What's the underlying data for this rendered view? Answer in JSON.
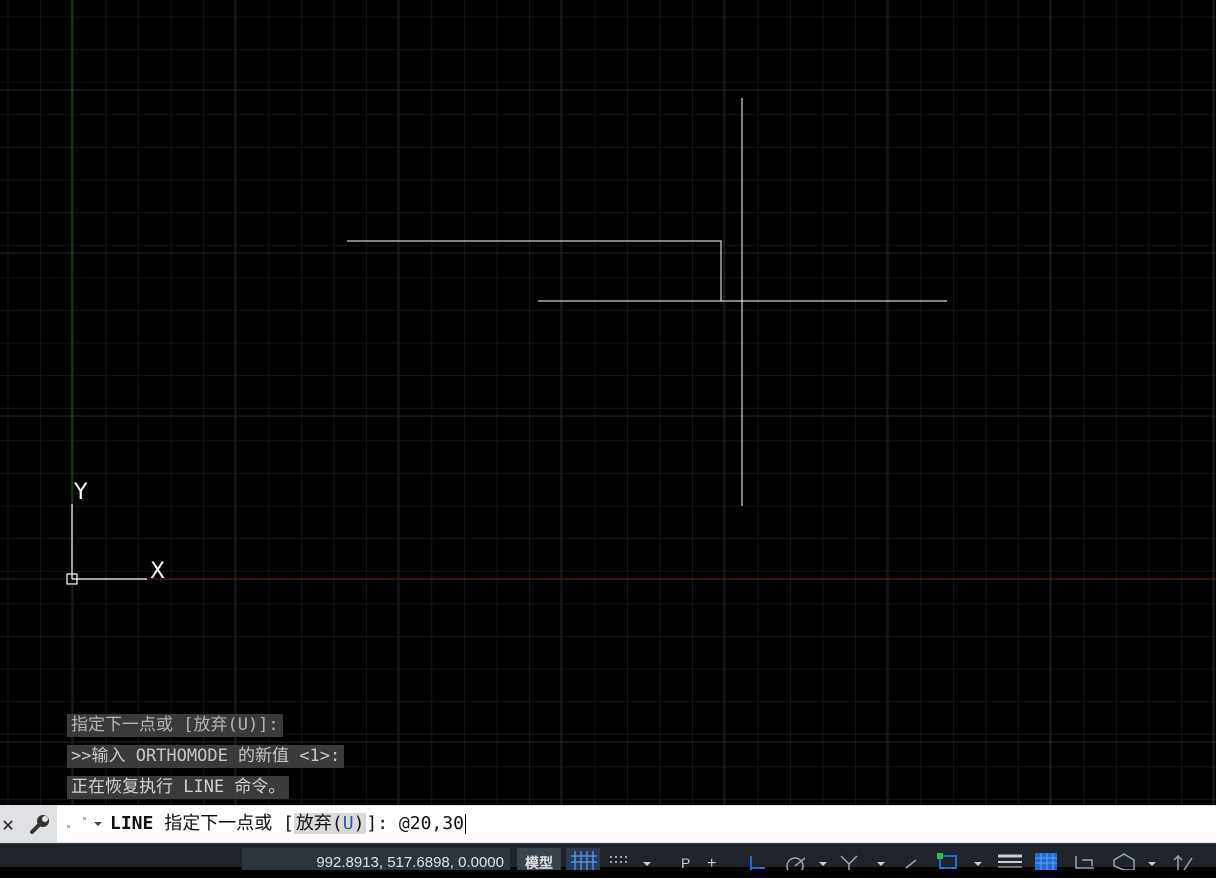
{
  "drawing": {
    "ucs_icon": {
      "y_label": "Y",
      "x_label": "X"
    }
  },
  "command_history": [
    "指定下一点或 [放弃(U)]:",
    ">>输入 ORTHOMODE 的新值 <1>:",
    "正在恢复执行 LINE 命令。"
  ],
  "command_line": {
    "close_icon": "close-icon",
    "customize_icon": "wrench-icon",
    "prefix": "LINE",
    "prompt": " 指定下一点或 [",
    "option_text": "放弃(",
    "option_key": "U",
    "option_close": ")",
    "prompt_end": "]: ",
    "value": "@20,30"
  },
  "status_bar": {
    "coordinates": "992.8913, 517.6898, 0.0000",
    "model_label": "模型",
    "icons": [
      "grid-icon",
      "snap-grid-icon",
      "infer-icon",
      "snap-icon",
      "ortho-icon",
      "polar-icon",
      "isodraft-icon",
      "osnap-track-icon",
      "osnap-icon",
      "lineweight-icon",
      "transparency-icon",
      "selection-cycling-icon",
      "3d-osnap-icon",
      "dyn-ucs-icon"
    ]
  },
  "colors": {
    "background": "#000000",
    "grid_minor": "#121418",
    "grid_major": "#222630",
    "x_axis": "#7a1e1e",
    "y_axis": "#1e6a1e",
    "geometry": "#ffffff",
    "status_active": "#1f6bd8"
  }
}
